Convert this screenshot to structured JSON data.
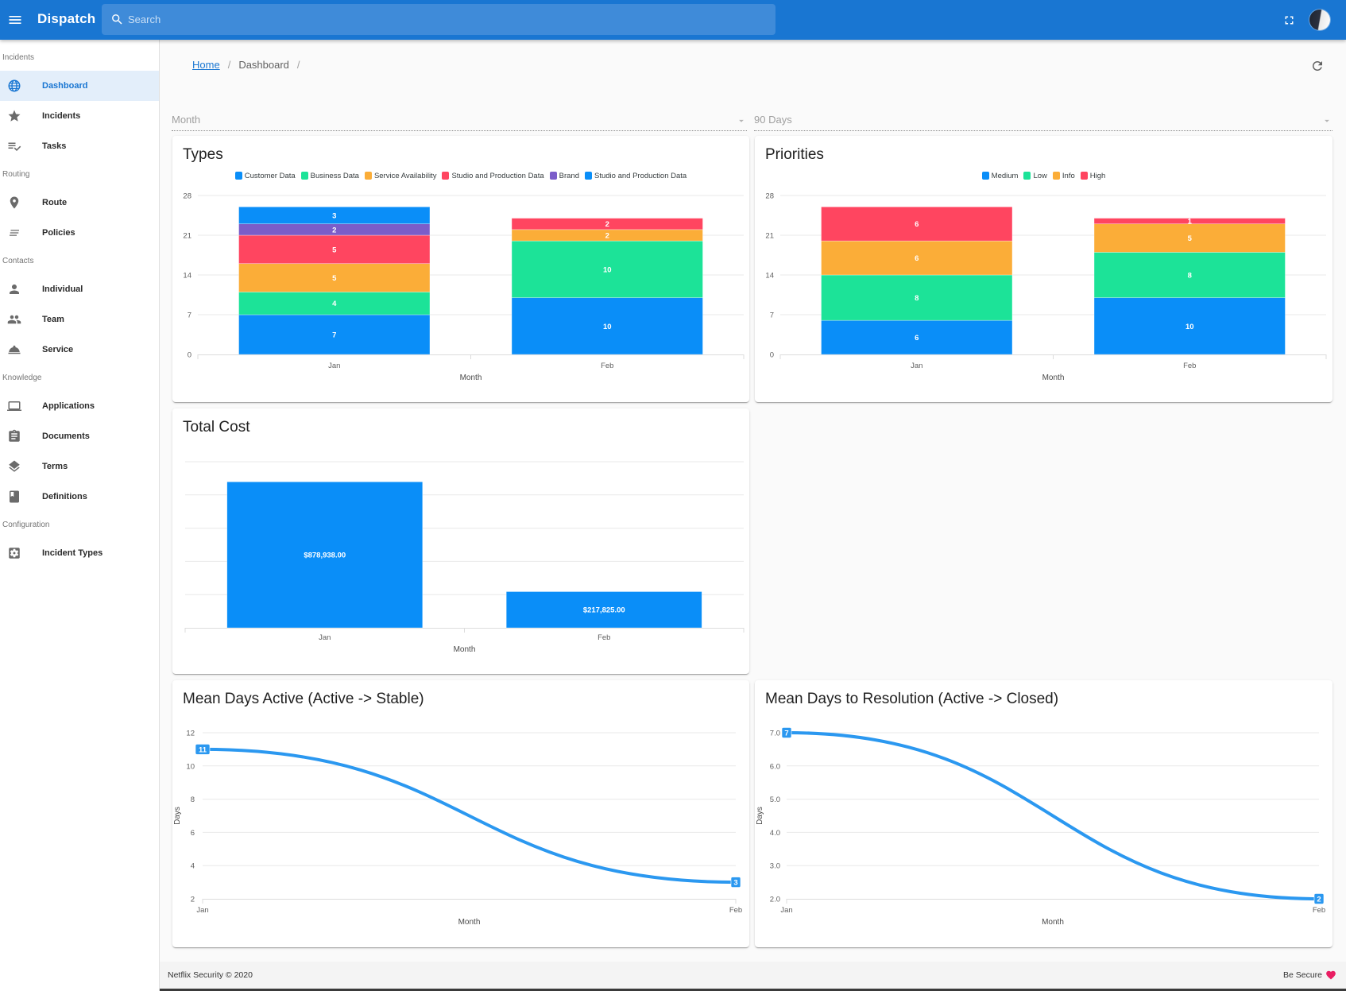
{
  "app": {
    "title": "Dispatch",
    "search_placeholder": "Search"
  },
  "colors": {
    "primary": "#1976d2",
    "active_bg": "#e3eefa",
    "heart": "#e91e63"
  },
  "sidebar": {
    "sections": [
      {
        "header": "Incidents",
        "items": [
          {
            "label": "Dashboard",
            "icon": "globe-icon",
            "active": true
          },
          {
            "label": "Incidents",
            "icon": "star-icon"
          },
          {
            "label": "Tasks",
            "icon": "playlist-check-icon"
          }
        ]
      },
      {
        "header": "Routing",
        "items": [
          {
            "label": "Route",
            "icon": "place-icon"
          },
          {
            "label": "Policies",
            "icon": "text-lines-icon"
          }
        ]
      },
      {
        "header": "Contacts",
        "items": [
          {
            "label": "Individual",
            "icon": "person-icon"
          },
          {
            "label": "Team",
            "icon": "people-icon"
          },
          {
            "label": "Service",
            "icon": "room-service-icon"
          }
        ]
      },
      {
        "header": "Knowledge",
        "items": [
          {
            "label": "Applications",
            "icon": "laptop-icon"
          },
          {
            "label": "Documents",
            "icon": "clipboard-icon"
          },
          {
            "label": "Terms",
            "icon": "layers-icon"
          },
          {
            "label": "Definitions",
            "icon": "book-icon"
          }
        ]
      },
      {
        "header": "Configuration",
        "items": [
          {
            "label": "Incident Types",
            "icon": "settings-applications-icon"
          }
        ]
      }
    ]
  },
  "breadcrumb": {
    "home": "Home",
    "current": "Dashboard",
    "separator": "/"
  },
  "filters": {
    "group_by": {
      "value": "Month"
    },
    "window": {
      "value": "90 Days"
    }
  },
  "chart_data": [
    {
      "id": "types",
      "type": "bar",
      "stacked": true,
      "title": "Types",
      "categories": [
        "Jan",
        "Feb"
      ],
      "xlabel": "Month",
      "ylabel": "",
      "ylim": [
        0,
        28
      ],
      "yticks": [
        0,
        7,
        14,
        21,
        28
      ],
      "grid": true,
      "legend": "top-center",
      "series": [
        {
          "name": "Customer Data",
          "color": "#0a8ef8",
          "values": [
            7,
            10
          ]
        },
        {
          "name": "Business Data",
          "color": "#1ce398",
          "values": [
            4,
            10
          ]
        },
        {
          "name": "Service Availability",
          "color": "#fbad38",
          "values": [
            5,
            2
          ]
        },
        {
          "name": "Studio and Production Data",
          "color": "#ff4560",
          "values": [
            5,
            2
          ]
        },
        {
          "name": "Brand",
          "color": "#7b5dc9",
          "values": [
            2,
            0
          ]
        },
        {
          "name": "Studio and Production Data",
          "color": "#0a8ef8",
          "values": [
            3,
            0
          ]
        }
      ]
    },
    {
      "id": "priorities",
      "type": "bar",
      "stacked": true,
      "title": "Priorities",
      "categories": [
        "Jan",
        "Feb"
      ],
      "xlabel": "Month",
      "ylabel": "",
      "ylim": [
        0,
        28
      ],
      "yticks": [
        0,
        7,
        14,
        21,
        28
      ],
      "grid": true,
      "legend": "top-center",
      "series": [
        {
          "name": "Medium",
          "color": "#0a8ef8",
          "values": [
            6,
            10
          ]
        },
        {
          "name": "Low",
          "color": "#1ce398",
          "values": [
            8,
            8
          ]
        },
        {
          "name": "Info",
          "color": "#fbad38",
          "values": [
            6,
            5
          ]
        },
        {
          "name": "High",
          "color": "#ff4560",
          "values": [
            6,
            1
          ]
        }
      ]
    },
    {
      "id": "total-cost",
      "type": "bar",
      "stacked": false,
      "title": "Total Cost",
      "categories": [
        "Jan",
        "Feb"
      ],
      "xlabel": "Month",
      "ylabel": "",
      "ylim": [
        0,
        1000000
      ],
      "yticks": [
        0,
        200000,
        400000,
        600000,
        800000,
        1000000
      ],
      "show_ytick_labels": false,
      "grid": true,
      "legend": "none",
      "series": [
        {
          "color": "#0a8ef8",
          "values": [
            878938.0,
            217825.0
          ],
          "labels": [
            "$878,938.00",
            "$217,825.00"
          ]
        }
      ]
    },
    {
      "id": "mean-days-active",
      "type": "line",
      "title": "Mean Days Active (Active -> Stable)",
      "categories": [
        "Jan",
        "Feb"
      ],
      "xlabel": "Month",
      "ylabel": "Days",
      "ylim": [
        2,
        12
      ],
      "yticks": [
        2,
        4,
        6,
        8,
        10,
        12
      ],
      "grid": true,
      "legend": "none",
      "curve": "smooth",
      "series": [
        {
          "color": "#2b98f0",
          "values": [
            11,
            3
          ]
        }
      ]
    },
    {
      "id": "mean-days-resolution",
      "type": "line",
      "title": "Mean Days to Resolution (Active -> Closed)",
      "categories": [
        "Jan",
        "Feb"
      ],
      "xlabel": "Month",
      "ylabel": "Days",
      "ylim": [
        2,
        7
      ],
      "yticks": [
        2,
        3,
        4,
        5,
        6,
        7
      ],
      "ytick_labels": [
        "2.0",
        "3.0",
        "4.0",
        "5.0",
        "6.0",
        "7.0"
      ],
      "grid": true,
      "legend": "none",
      "curve": "smooth",
      "series": [
        {
          "color": "#2b98f0",
          "values": [
            7,
            2
          ]
        }
      ]
    }
  ],
  "footer": {
    "left": "Netflix Security © 2020",
    "right": "Be Secure"
  }
}
